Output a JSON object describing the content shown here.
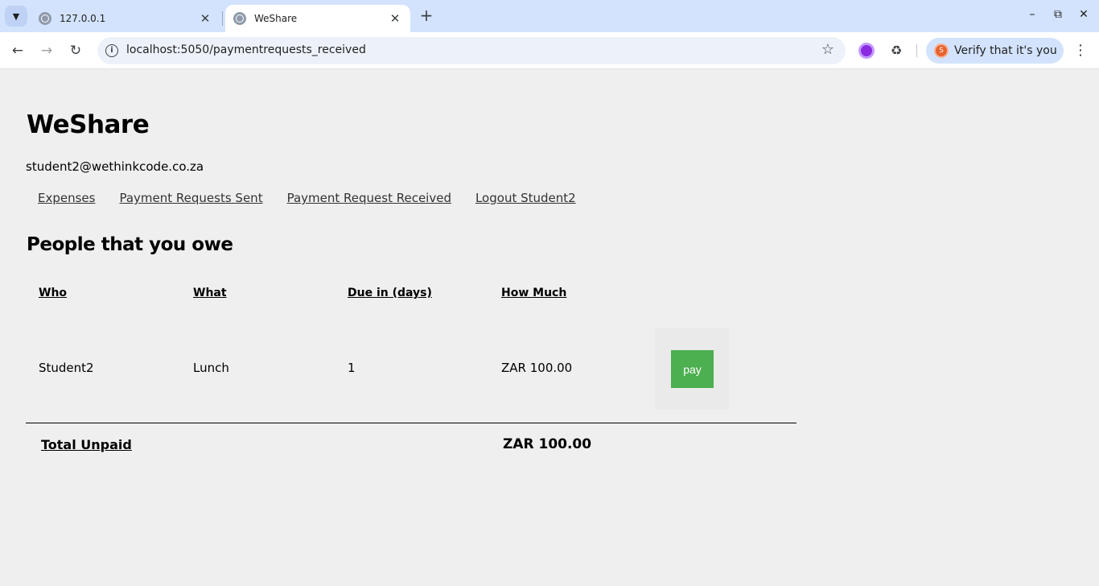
{
  "browser": {
    "tabs": [
      {
        "title": "127.0.0.1",
        "active": false
      },
      {
        "title": "WeShare",
        "active": true
      }
    ],
    "url": "localhost:5050/paymentrequests_received",
    "profile_label": "Verify that it's you",
    "profile_initial": "S"
  },
  "app": {
    "title": "WeShare",
    "user_email": "student2@wethinkcode.co.za",
    "nav": [
      {
        "label": "Expenses"
      },
      {
        "label": "Payment Requests Sent"
      },
      {
        "label": "Payment Request Received"
      },
      {
        "label": "Logout Student2"
      }
    ],
    "section_title": "People that you owe",
    "table": {
      "headers": [
        "Who",
        "What",
        "Due in (days)",
        "How Much"
      ],
      "rows": [
        {
          "who": "Student2",
          "what": "Lunch",
          "due": "1",
          "amount": "ZAR 100.00",
          "action": "pay"
        }
      ],
      "total_label": "Total Unpaid",
      "total_value": "ZAR 100.00"
    },
    "colors": {
      "pay_button": "#4caf50",
      "page_background": "#efefef"
    }
  }
}
